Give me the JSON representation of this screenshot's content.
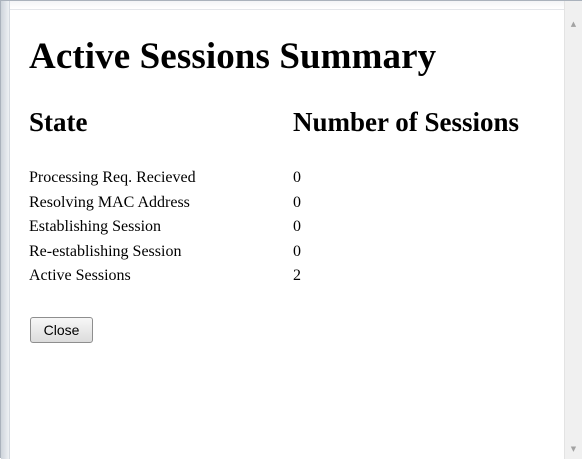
{
  "page": {
    "title": "Active Sessions Summary",
    "columns": {
      "state": "State",
      "count": "Number of Sessions"
    },
    "rows": [
      {
        "state": "Processing Req. Recieved",
        "count": "0"
      },
      {
        "state": "Resolving MAC Address",
        "count": "0"
      },
      {
        "state": "Establishing Session",
        "count": "0"
      },
      {
        "state": "Re-establishing Session",
        "count": "0"
      },
      {
        "state": "Active Sessions",
        "count": "2"
      }
    ],
    "close_label": "Close"
  },
  "scrollbar": {
    "up_icon": "arrow-up-icon",
    "down_icon": "arrow-down-icon"
  },
  "colors": {
    "background": "#ffffff",
    "text": "#000000",
    "button_border": "#8e8e8e",
    "scrollbar_bg": "#f0f0f0"
  }
}
